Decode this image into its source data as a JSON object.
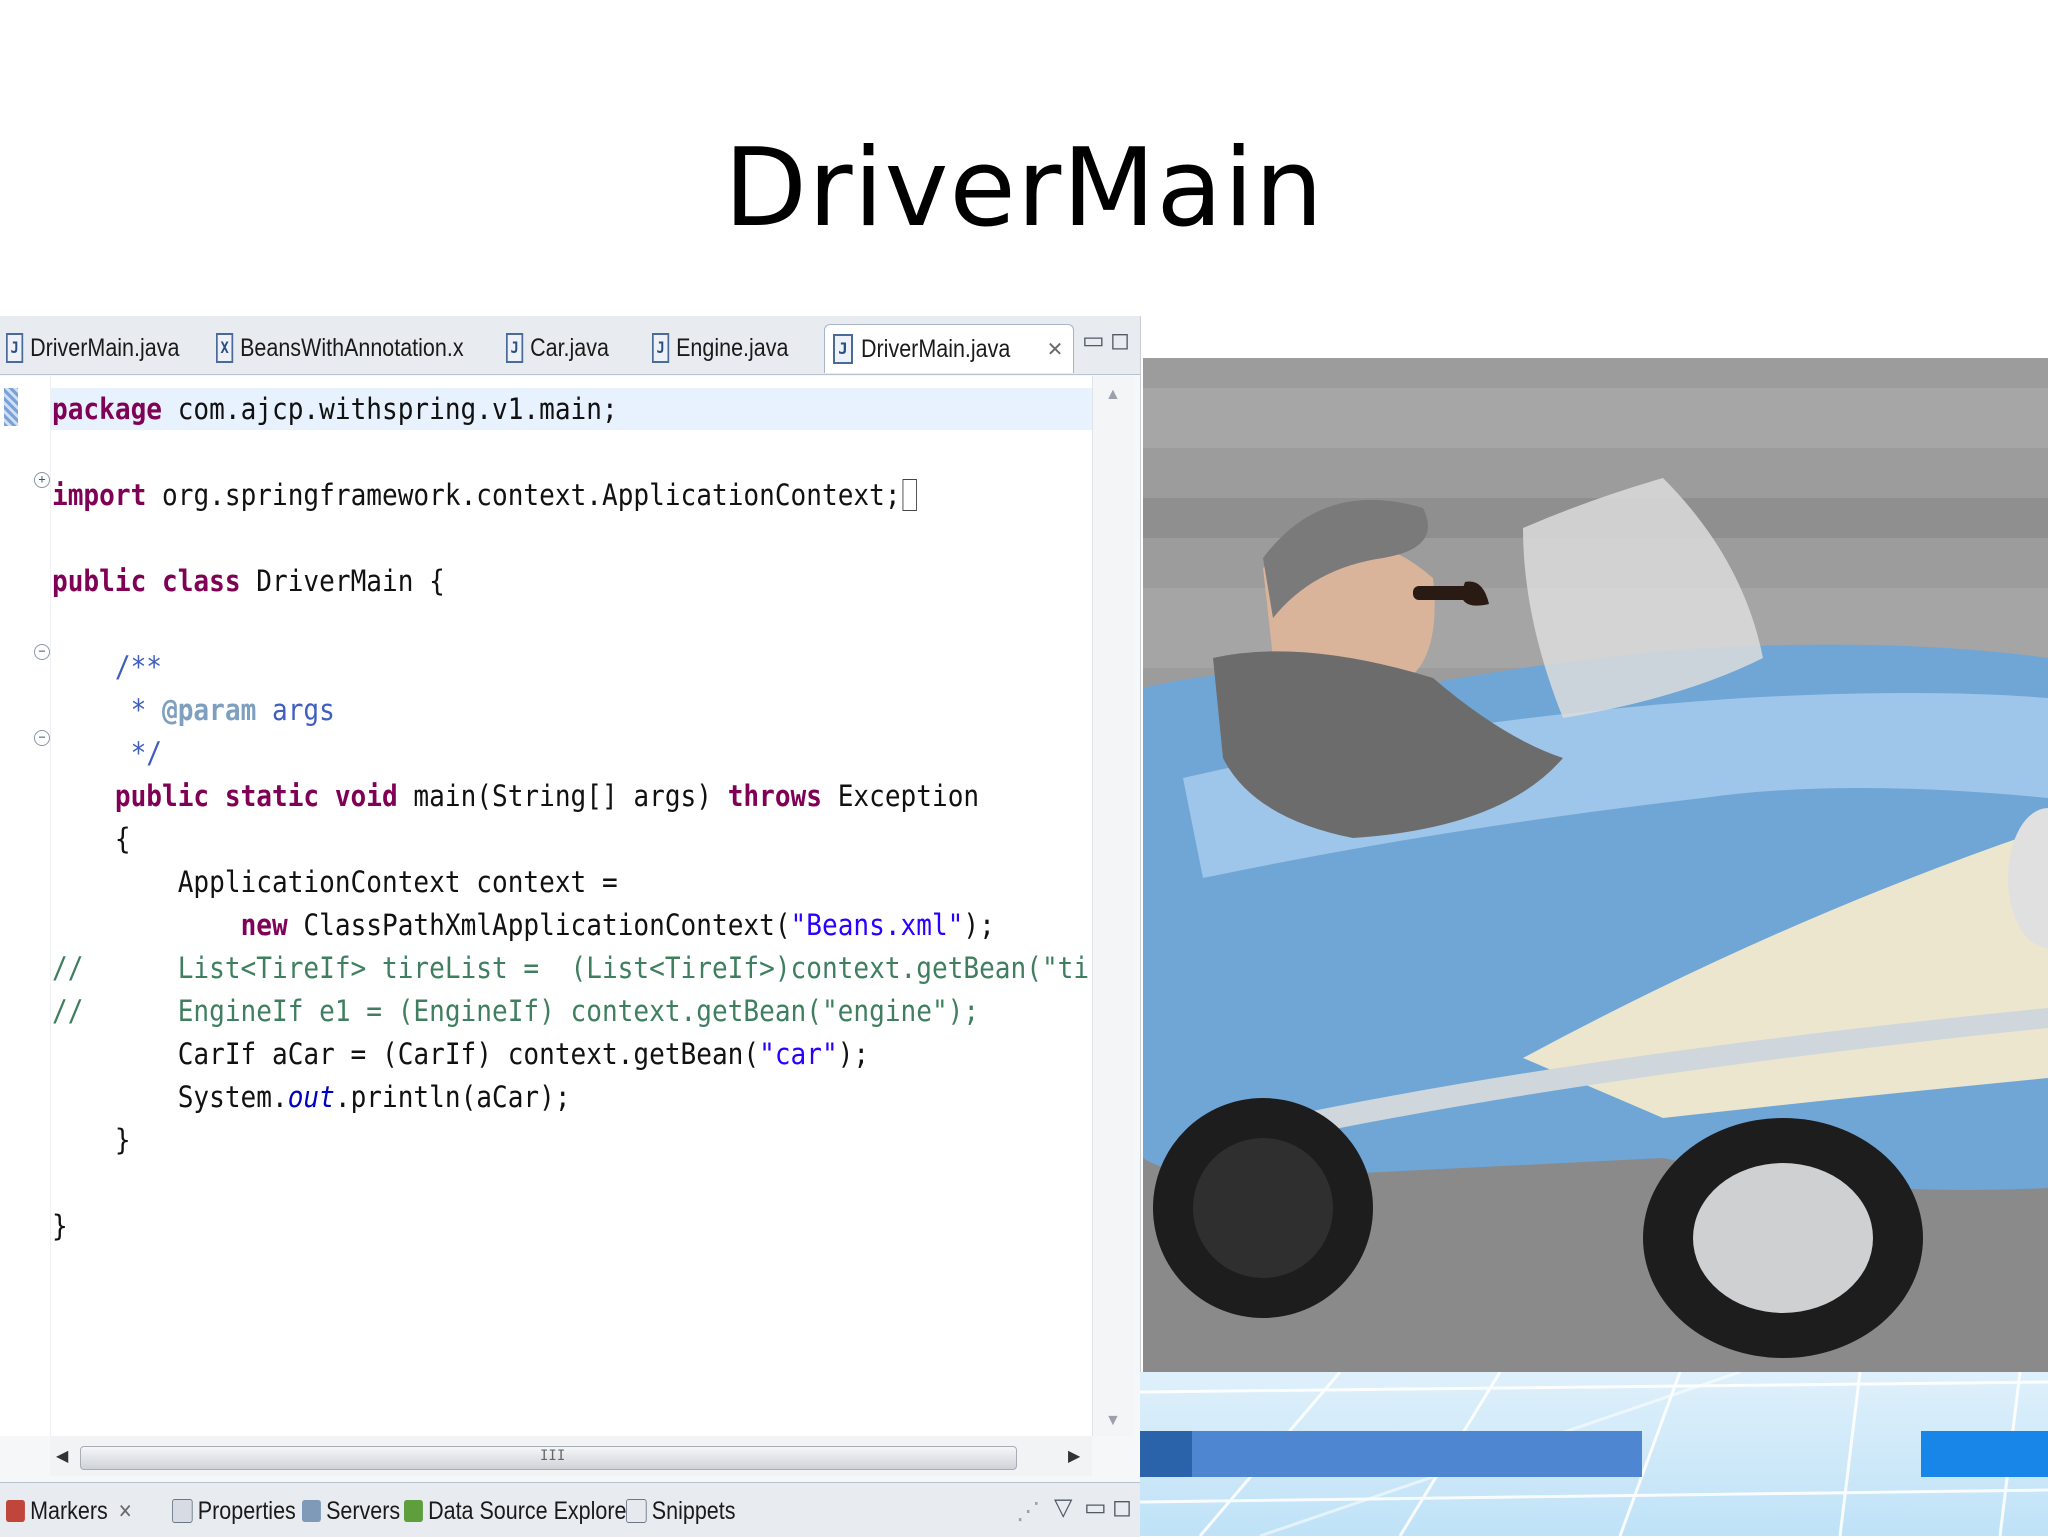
{
  "slide": {
    "title": "DriverMain"
  },
  "editor": {
    "tabs": [
      {
        "label": "DriverMain.java",
        "icon": "java-file-icon"
      },
      {
        "label": "BeansWithAnnotation.x",
        "icon": "xml-file-icon"
      },
      {
        "label": "Car.java",
        "icon": "java-file-icon"
      },
      {
        "label": "Engine.java",
        "icon": "java-file-icon"
      },
      {
        "label": "DriverMain.java",
        "icon": "java-file-icon",
        "active": true
      }
    ],
    "code_lines": [
      "package com.ajcp.withspring.v1.main;",
      "",
      "import org.springframework.context.ApplicationContext;",
      "",
      "public class DriverMain {",
      "",
      "    /**",
      "     * @param args",
      "     */",
      "    public static void main(String[] args) throws Exception",
      "    {",
      "        ApplicationContext context =",
      "            new ClassPathXmlApplicationContext(\"Beans.xml\");",
      "//      List<TireIf> tireList =  (List<TireIf>)context.getBean(\"tireList",
      "//      EngineIf e1 = (EngineIf) context.getBean(\"engine\");",
      "        CarIf aCar = (CarIf) context.getBean(\"car\");",
      "        System.out.println(aCar);",
      "    }",
      "",
      "}"
    ],
    "hscroll_grip": "III"
  },
  "views": {
    "tabs": [
      {
        "label": "Markers",
        "icon": "markers-icon",
        "closable": true
      },
      {
        "label": "Properties",
        "icon": "properties-icon"
      },
      {
        "label": "Servers",
        "icon": "servers-icon"
      },
      {
        "label": "Data Source Explorer",
        "icon": "data-source-icon"
      },
      {
        "label": "Snippets",
        "icon": "snippets-icon"
      }
    ]
  },
  "colors": {
    "keyword": "#7f0055",
    "string": "#2a00ff",
    "comment": "#3f7f5f",
    "javadoc": "#3f5fbf",
    "accent_blue": "#4f86d2"
  }
}
